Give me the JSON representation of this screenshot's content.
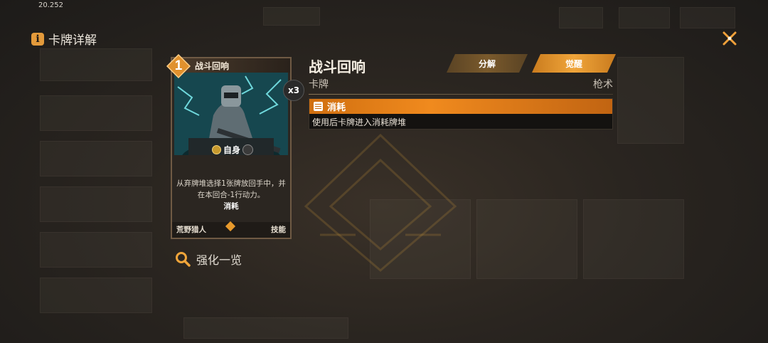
{
  "status_bar": {
    "time": "20.252"
  },
  "header": {
    "title": "卡牌详解",
    "info_icon": "info-icon",
    "close_icon": "close-icon"
  },
  "card": {
    "cost": "1",
    "name": "战斗回响",
    "count": "x3",
    "target": "自身",
    "description": "从弃牌堆选择1张牌放回手中，并在本回合-1行动力。",
    "keyword": "消耗",
    "class": "荒野猎人",
    "type": "技能"
  },
  "search": {
    "label": "强化一览",
    "icon": "search-icon"
  },
  "detail": {
    "name": "战斗回响",
    "category": "卡牌",
    "subcategory": "枪术",
    "buttons": {
      "decompose": "分解",
      "awaken": "觉醒"
    },
    "keyword_box": {
      "title": "消耗",
      "icon": "document-icon",
      "text": "使用后卡牌进入消耗牌堆"
    }
  },
  "colors": {
    "accent": "#f08a1e",
    "button_gold": "#f0a53a",
    "background": "#2a2520"
  }
}
